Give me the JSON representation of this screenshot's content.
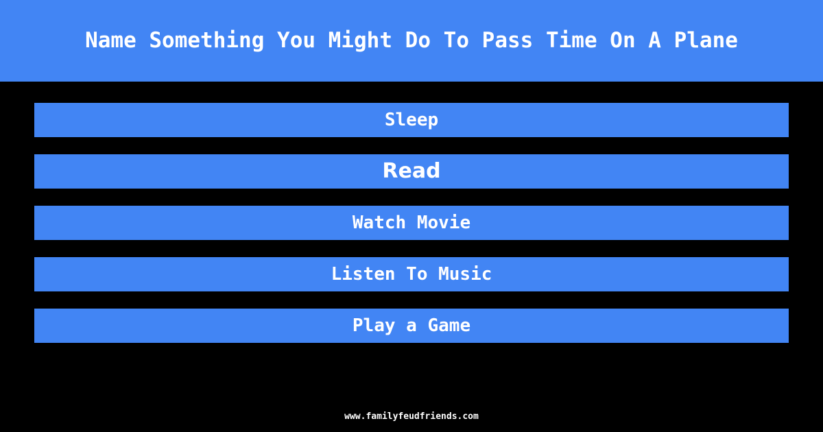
{
  "colors": {
    "accent_blue": "#4285f4",
    "background": "#000000",
    "text_white": "#ffffff"
  },
  "header": {
    "title": "Name Something You Might Do To Pass Time On A Plane"
  },
  "answers": [
    {
      "label": "Sleep",
      "font": "mono"
    },
    {
      "label": "Read",
      "font": "proportional"
    },
    {
      "label": "Watch Movie",
      "font": "mono"
    },
    {
      "label": "Listen To Music",
      "font": "mono"
    },
    {
      "label": "Play a Game",
      "font": "mono"
    }
  ],
  "footer": {
    "url": "www.familyfeudfriends.com"
  }
}
